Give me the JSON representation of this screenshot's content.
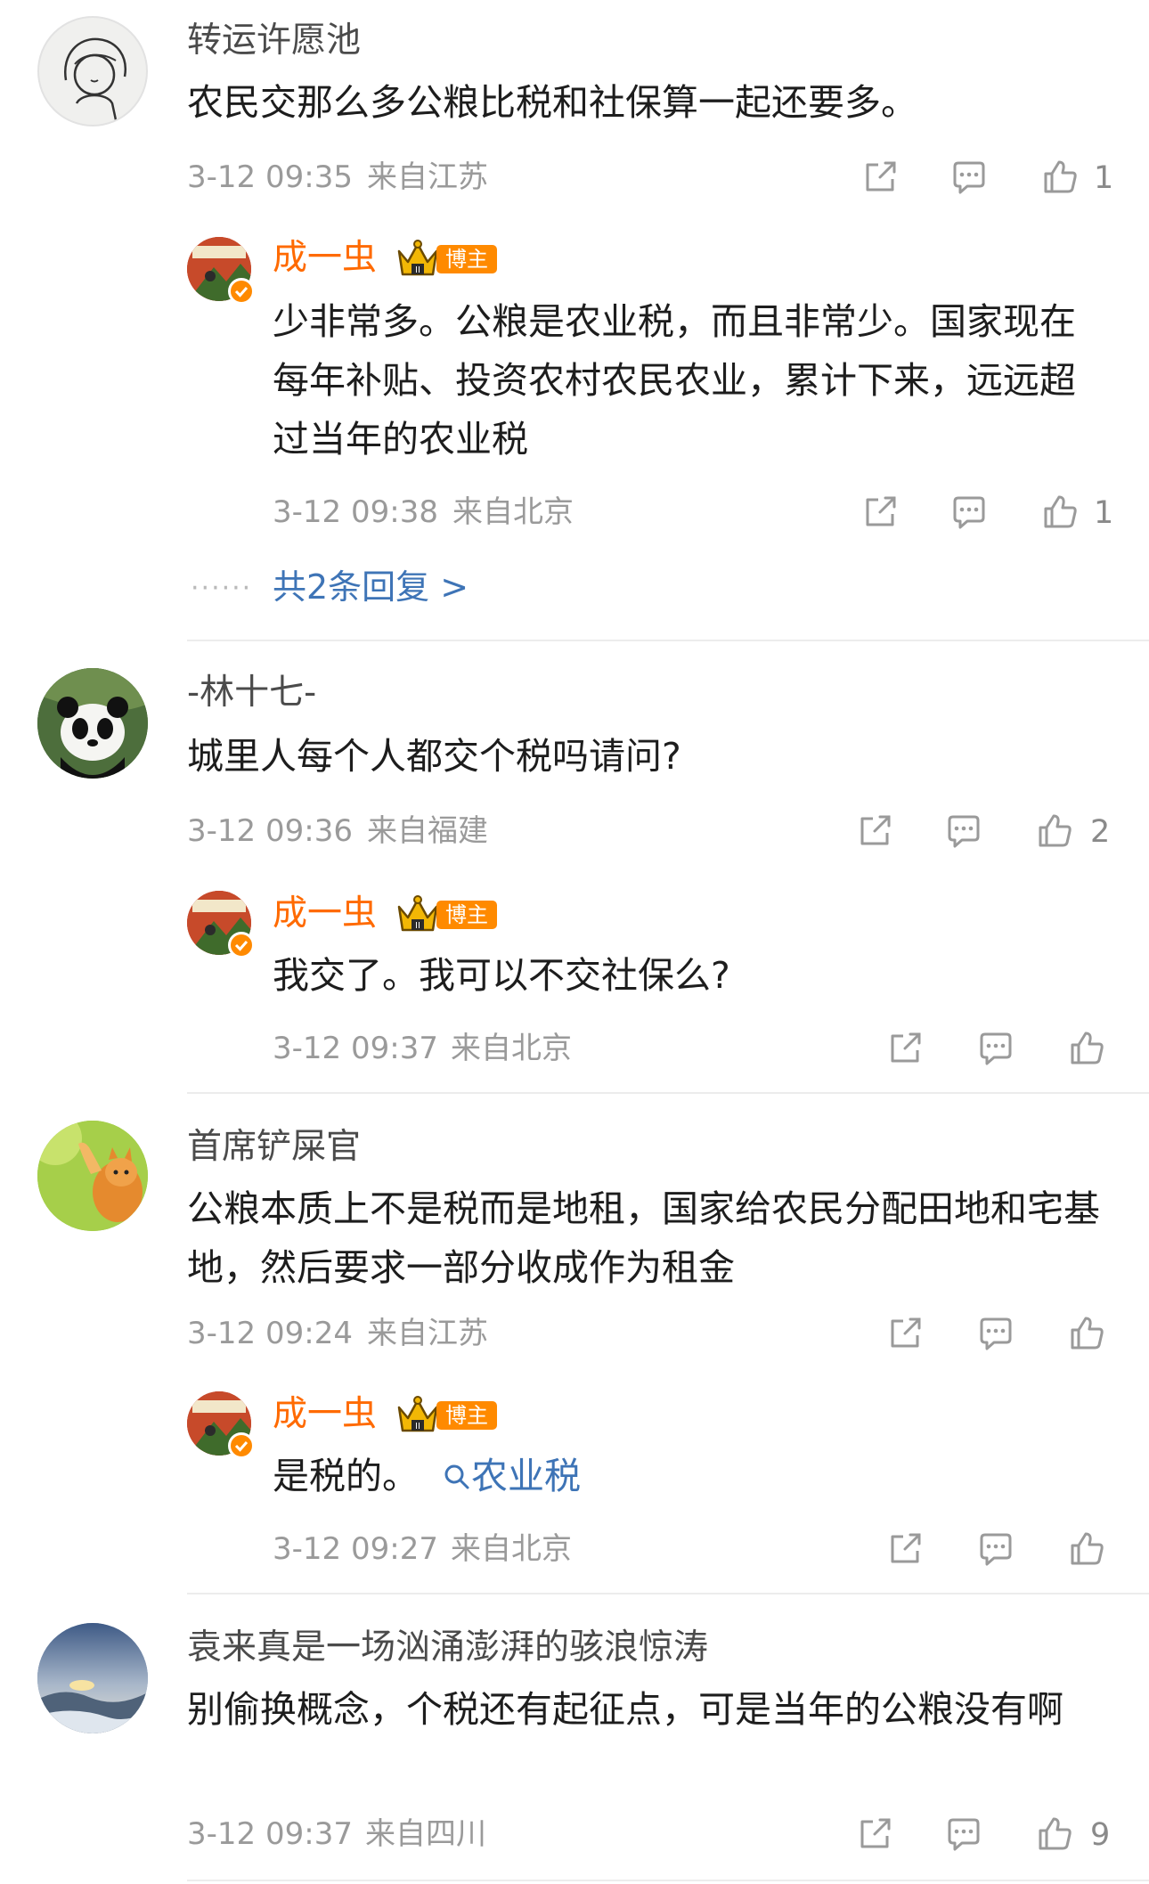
{
  "comments": [
    {
      "user": "转运许愿池",
      "text": "农民交那么多公粮比税和社保算一起还要多。",
      "time": "3-12 09:35",
      "location": "来自江苏",
      "likes": "1",
      "reply": {
        "user": "成一虫",
        "badge": "博主",
        "text": "少非常多。公粮是农业税，而且非常少。国家现在每年补贴、投资农村农民农业，累计下来，远远超过当年的农业税",
        "time": "3-12 09:38",
        "location": "来自北京",
        "likes": "1"
      },
      "more_replies": "共2条回复 >"
    },
    {
      "user": "-林十七-",
      "text": "城里人每个人都交个税吗请问?",
      "time": "3-12 09:36",
      "location": "来自福建",
      "likes": "2",
      "reply": {
        "user": "成一虫",
        "badge": "博主",
        "text": "我交了。我可以不交社保么?",
        "time": "3-12 09:37",
        "location": "来自北京",
        "likes": ""
      }
    },
    {
      "user": "首席铲屎官",
      "text": "公粮本质上不是税而是地租，国家给农民分配田地和宅基地，然后要求一部分收成作为租金",
      "time": "3-12 09:24",
      "location": "来自江苏",
      "likes": "",
      "reply": {
        "user": "成一虫",
        "badge": "博主",
        "text": "是税的。",
        "topic_link": "农业税",
        "time": "3-12 09:27",
        "location": "来自北京",
        "likes": ""
      }
    },
    {
      "user": "袁来真是一场汹涌澎湃的骇浪惊涛",
      "text": "别偷换概念，个税还有起征点，可是当年的公粮没有啊",
      "time": "3-12 09:37",
      "location": "来自四川",
      "likes": "9"
    }
  ],
  "icons": {
    "share": "share-icon",
    "comment": "comment-icon",
    "like": "thumbs-up-icon",
    "search": "search-icon",
    "crown": "crown-icon",
    "verified": "verified-icon"
  },
  "colors": {
    "author_name": "#ff6a00",
    "badge_bg": "#ff8a00",
    "link": "#3e74b6",
    "meta": "#9a9a9a"
  }
}
